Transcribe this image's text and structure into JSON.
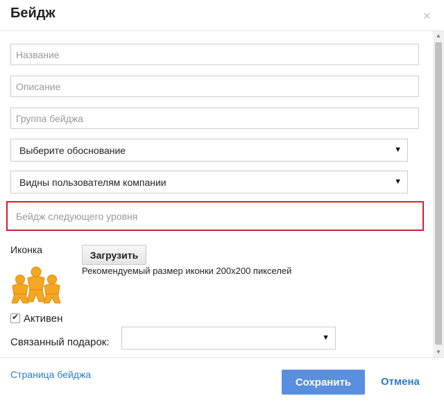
{
  "dialog": {
    "title": "Бейдж",
    "close_glyph": "×"
  },
  "form": {
    "name_placeholder": "Название",
    "description_placeholder": "Описание",
    "group_placeholder": "Группа бейджа",
    "reason_select": {
      "value": "Выберите обоснование",
      "icon": "caret-down-icon"
    },
    "visibility_select": {
      "value": "Видны пользователям компании",
      "icon": "caret-down-icon"
    },
    "next_level_placeholder": "Бейдж следующего уровня",
    "icon_label": "Иконка",
    "upload_label": "Загрузить",
    "icon_hint": "Рекомендуемый размер иконки 200x200 пикселей",
    "active_label": "Активен",
    "active_checked": true,
    "linked_gift_label": "Связанный подарок:",
    "linked_gift_value": ""
  },
  "footer": {
    "badge_page_link": "Страница бейджа",
    "save_label": "Сохранить",
    "cancel_label": "Отмена"
  },
  "colors": {
    "accent": "#5a8fe0",
    "link": "#2a7cc7",
    "highlight_border": "#c9232b",
    "badge_fill": "#f5a623"
  }
}
